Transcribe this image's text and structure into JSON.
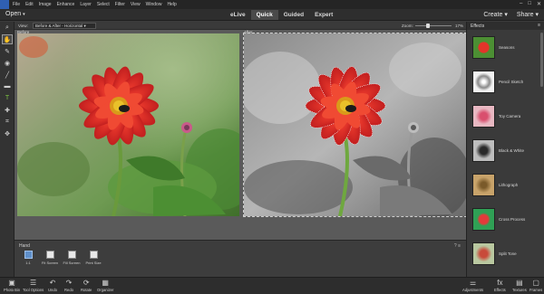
{
  "menu": [
    "File",
    "Edit",
    "Image",
    "Enhance",
    "Layer",
    "Select",
    "Filter",
    "View",
    "Window",
    "Help"
  ],
  "open_label": "Open",
  "modes": [
    "eLive",
    "Quick",
    "Guided",
    "Expert"
  ],
  "active_mode": "Quick",
  "create_label": "Create",
  "share_label": "Share",
  "view": {
    "label": "View:",
    "value": "Before & After - Horizontal"
  },
  "zoom": {
    "label": "Zoom:",
    "value": "17%"
  },
  "before_label": "Before",
  "after_label": "After",
  "options": {
    "title": "Hand",
    "items": [
      "1:1",
      "Fit Screen",
      "Fill Screen",
      "Print Size"
    ]
  },
  "effects": {
    "title": "Effects",
    "items": [
      "Seasons",
      "Pencil Sketch",
      "Toy Camera",
      "Black & White",
      "Lithograph",
      "Cross Process",
      "Split Tone",
      ""
    ]
  },
  "taskbar_left": [
    "Photo Bin",
    "Tool Options",
    "Undo",
    "Redo",
    "Rotate",
    "Organizer"
  ],
  "taskbar_right": [
    "Adjustments",
    "Effects",
    "Textures",
    "Frames"
  ],
  "colors": {
    "accent": "#5f8fc9",
    "flower": "#e3342a"
  }
}
